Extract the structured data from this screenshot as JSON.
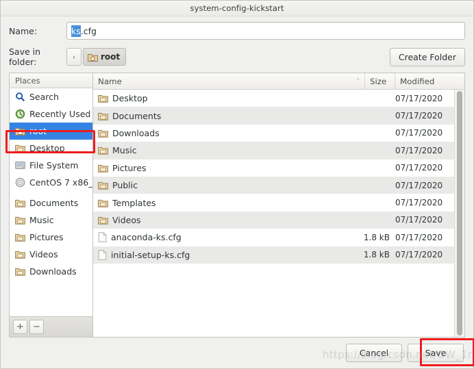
{
  "window": {
    "title": "system-config-kickstart"
  },
  "name_row": {
    "label": "Name:",
    "value_selected": "ks",
    "value_rest": ".cfg",
    "full_value": "ks.cfg"
  },
  "path_row": {
    "label": "Save in folder:",
    "back_glyph": "‹",
    "current_folder": "root",
    "create_folder_label": "Create Folder"
  },
  "sidebar": {
    "header": "Places",
    "items": [
      {
        "label": "Search",
        "icon": "search-icon",
        "selected": false,
        "gap_before": false
      },
      {
        "label": "Recently Used",
        "icon": "clock-icon",
        "selected": false,
        "gap_before": false
      },
      {
        "label": "root",
        "icon": "home-folder-icon",
        "selected": true,
        "gap_before": false
      },
      {
        "label": "Desktop",
        "icon": "folder-icon",
        "selected": false,
        "gap_before": false
      },
      {
        "label": "File System",
        "icon": "drive-icon",
        "selected": false,
        "gap_before": false
      },
      {
        "label": "CentOS 7 x86_...",
        "icon": "disc-icon",
        "selected": false,
        "gap_before": false
      },
      {
        "label": "Documents",
        "icon": "folder-icon",
        "selected": false,
        "gap_before": true
      },
      {
        "label": "Music",
        "icon": "folder-icon",
        "selected": false,
        "gap_before": false
      },
      {
        "label": "Pictures",
        "icon": "folder-icon",
        "selected": false,
        "gap_before": false
      },
      {
        "label": "Videos",
        "icon": "folder-icon",
        "selected": false,
        "gap_before": false
      },
      {
        "label": "Downloads",
        "icon": "folder-icon",
        "selected": false,
        "gap_before": false
      }
    ],
    "add_label": "+",
    "remove_label": "−"
  },
  "filelist": {
    "columns": [
      "Name",
      "Size",
      "Modified"
    ],
    "sort_indicator": "˅",
    "rows": [
      {
        "name": "Desktop",
        "size": "",
        "modified": "07/17/2020",
        "type": "folder"
      },
      {
        "name": "Documents",
        "size": "",
        "modified": "07/17/2020",
        "type": "folder"
      },
      {
        "name": "Downloads",
        "size": "",
        "modified": "07/17/2020",
        "type": "folder"
      },
      {
        "name": "Music",
        "size": "",
        "modified": "07/17/2020",
        "type": "folder"
      },
      {
        "name": "Pictures",
        "size": "",
        "modified": "07/17/2020",
        "type": "folder"
      },
      {
        "name": "Public",
        "size": "",
        "modified": "07/17/2020",
        "type": "folder"
      },
      {
        "name": "Templates",
        "size": "",
        "modified": "07/17/2020",
        "type": "folder"
      },
      {
        "name": "Videos",
        "size": "",
        "modified": "07/17/2020",
        "type": "folder"
      },
      {
        "name": "anaconda-ks.cfg",
        "size": "1.8 kB",
        "modified": "07/17/2020",
        "type": "file"
      },
      {
        "name": "initial-setup-ks.cfg",
        "size": "1.8 kB",
        "modified": "07/17/2020",
        "type": "file"
      }
    ]
  },
  "footer": {
    "cancel_label": "Cancel",
    "save_label": "Save"
  },
  "watermark": {
    "text": "https://blog.csdn.net/GW_1r"
  },
  "annotations": {
    "highlight_color": "#ee1c1c",
    "boxes": [
      "root-sidebar-item",
      "save-button"
    ]
  }
}
